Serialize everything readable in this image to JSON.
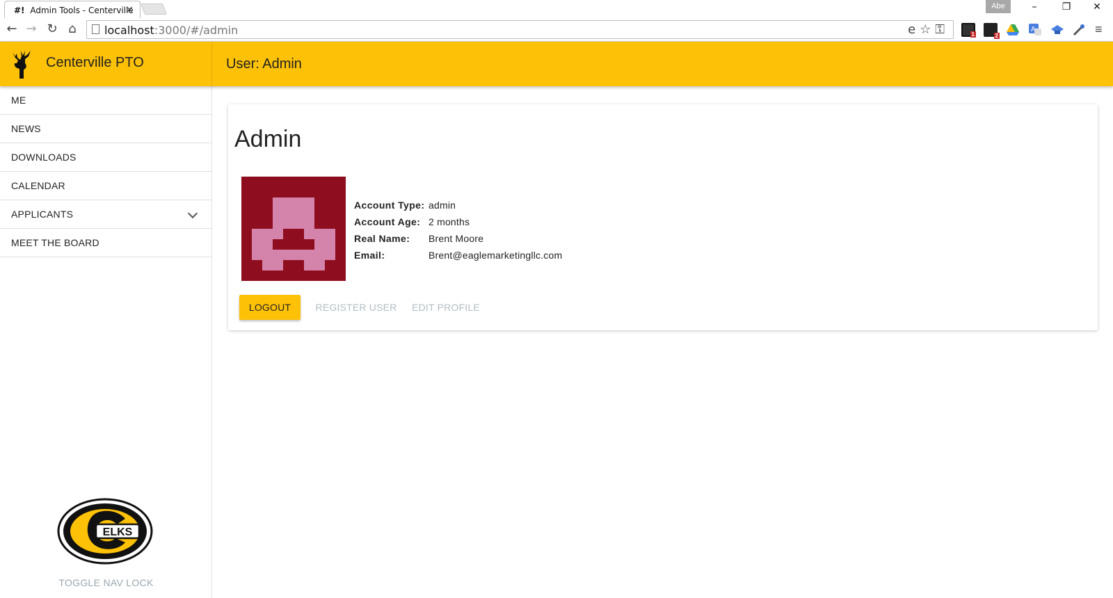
{
  "browser": {
    "tab": {
      "favicon": "#!",
      "title": "Admin Tools - Centerville",
      "close": "×"
    },
    "profile": "Abe",
    "window_buttons": {
      "minimize": "–",
      "restore": "❐",
      "close": "✕"
    },
    "nav": {
      "back": "←",
      "forward": "→",
      "reload": "↻",
      "home": "⌂"
    },
    "url": {
      "host": "localhost",
      "path": ":3000/#/admin"
    },
    "omnibox_icons": "e☆⚿",
    "menu": "≡",
    "extension_badges": [
      "1",
      "2"
    ]
  },
  "header": {
    "brand_title": "Centerville PTO",
    "heading": "User: Admin"
  },
  "sidebar": {
    "items": [
      {
        "label": "ME"
      },
      {
        "label": "NEWS"
      },
      {
        "label": "DOWNLOADS"
      },
      {
        "label": "CALENDAR"
      },
      {
        "label": "APPLICANTS",
        "expandable": true
      },
      {
        "label": "MEET THE BOARD"
      }
    ],
    "logo_text": "ELKS",
    "toggle_label": "TOGGLE NAV LOCK"
  },
  "profile": {
    "title": "Admin",
    "fields": [
      {
        "key": "Account Type:",
        "value": "admin"
      },
      {
        "key": "Account Age:",
        "value": "2 months"
      },
      {
        "key": "Real Name:",
        "value": "Brent Moore"
      },
      {
        "key": "Email:",
        "value": "Brent@eaglemarketingllc.com"
      }
    ],
    "buttons": {
      "logout": "LOGOUT",
      "register": "REGISTER USER",
      "edit": "EDIT PROFILE"
    }
  },
  "colors": {
    "accent": "#fdc108",
    "identicon_bg": "#8e0d1e",
    "identicon_fg": "#d483ab",
    "muted_text": "#b3bdc3"
  }
}
